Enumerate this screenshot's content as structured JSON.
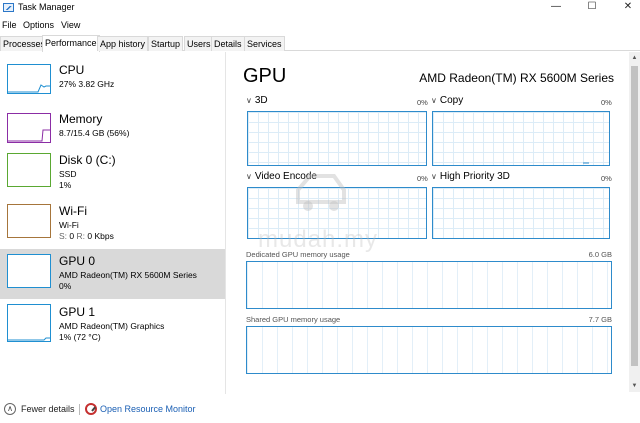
{
  "window": {
    "title": "Task Manager",
    "minimize": "—",
    "maximize": "☐",
    "close": "✕"
  },
  "menu": [
    "File",
    "Options",
    "View"
  ],
  "tabs": [
    "Processes",
    "Performance",
    "App history",
    "Startup",
    "Users",
    "Details",
    "Services"
  ],
  "active_tab": "Performance",
  "sidebar": {
    "items": [
      {
        "name": "CPU",
        "line1": "27%  3.82 GHz",
        "color": "#1f8fd1"
      },
      {
        "name": "Memory",
        "line1": "8.7/15.4 GB (56%)",
        "color": "#8b2da5"
      },
      {
        "name": "Disk 0 (C:)",
        "line1": "SSD",
        "line2": "1%",
        "color": "#5aa832"
      },
      {
        "name": "Wi-Fi",
        "line1": "Wi-Fi",
        "line2_s_label": "S:",
        "line2_s": "0",
        "line2_r_label": "R:",
        "line2_r": "0 Kbps",
        "color": "#a6753b"
      },
      {
        "name": "GPU 0",
        "line1": "AMD Radeon(TM) RX 5600M Series",
        "line2": "0%",
        "color": "#1f8fd1",
        "selected": true
      },
      {
        "name": "GPU 1",
        "line1": "AMD Radeon(TM) Graphics",
        "line2": "1%  (72 °C)",
        "color": "#1f8fd1"
      }
    ]
  },
  "main": {
    "title": "GPU",
    "model": "AMD Radeon(TM) RX 5600M Series",
    "engines": [
      {
        "name": "3D",
        "pct": "0%"
      },
      {
        "name": "Copy",
        "pct": "0%"
      },
      {
        "name": "Video Encode",
        "pct": "0%"
      },
      {
        "name": "High Priority 3D",
        "pct": "0%"
      }
    ],
    "dedicated_label": "Dedicated GPU memory usage",
    "dedicated_max": "6.0 GB",
    "shared_label": "Shared GPU memory usage",
    "shared_max": "7.7 GB"
  },
  "footer": {
    "fewer_details": "Fewer details",
    "open_resource_monitor": "Open Resource Monitor"
  },
  "watermark": "mudah.my",
  "accent_color": "#2e8bcb"
}
